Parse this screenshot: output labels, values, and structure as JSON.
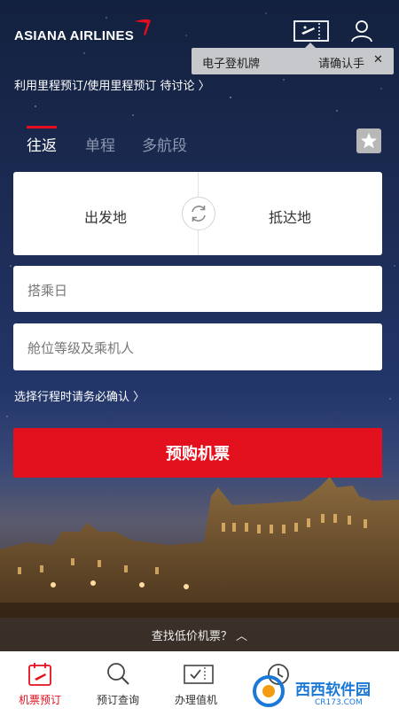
{
  "header": {
    "logo_text": "ASIANA AIRLINES",
    "tooltip": {
      "left": "电子登机牌",
      "right": "请确认手",
      "close_symbol": "✕"
    }
  },
  "mileage_link": "利用里程预订/使用里程预订 待讨论 〉",
  "tabs": [
    {
      "label": "往返",
      "active": true
    },
    {
      "label": "单程",
      "active": false
    },
    {
      "label": "多航段",
      "active": false
    }
  ],
  "route": {
    "departure_placeholder": "出发地",
    "arrival_placeholder": "抵达地"
  },
  "date_placeholder": "搭乘日",
  "cabin_placeholder": "舱位等级及乘机人",
  "notice_link": "选择行程时请务必确认 〉",
  "book_button": "预购机票",
  "lowfare_bar": "查找低价机票？ ︿",
  "bottom_nav": [
    {
      "label": "机票预订",
      "icon": "calendar-plane-icon",
      "active": true
    },
    {
      "label": "预订查询",
      "icon": "search-icon",
      "active": false
    },
    {
      "label": "办理值机",
      "icon": "boarding-pass-icon",
      "active": false
    },
    {
      "label": "",
      "icon": "clock-icon",
      "active": false
    }
  ],
  "watermark": {
    "text": "西西软件园",
    "sub": "CR173.COM"
  },
  "colors": {
    "brand_red": "#e3101e",
    "night_sky": "#1c2a4e",
    "tab_inactive": "#8d96ad"
  }
}
